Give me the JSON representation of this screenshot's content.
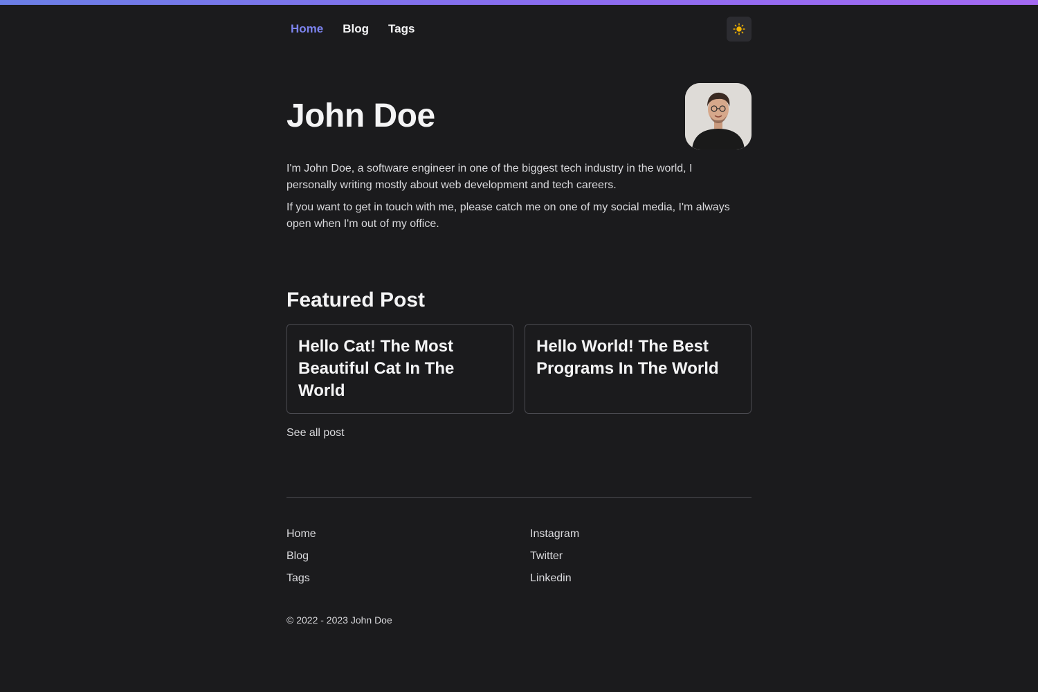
{
  "nav": {
    "links": [
      "Home",
      "Blog",
      "Tags"
    ],
    "active_index": 0,
    "theme_toggle_icon": "sun-icon"
  },
  "hero": {
    "name": "John Doe",
    "avatar_icon": "avatar-photo",
    "bio": [
      "I'm John Doe, a software engineer in one of the biggest tech industry in the world, I personally writing mostly about web development and tech careers.",
      "If you want to get in touch with me, please catch me on one of my social media, I'm always open when I'm out of my office."
    ]
  },
  "featured": {
    "heading": "Featured Post",
    "posts": [
      "Hello Cat! The Most Beautiful Cat In The World",
      "Hello World! The Best Programs In The World"
    ],
    "see_all": "See all post"
  },
  "footer": {
    "nav_links": [
      "Home",
      "Blog",
      "Tags"
    ],
    "social_links": [
      "Instagram",
      "Twitter",
      "Linkedin"
    ],
    "copyright": "© 2022 - 2023 John Doe"
  },
  "colors": {
    "background": "#1b1b1d",
    "accent": "#7c83ee",
    "sun": "#f4b400"
  }
}
